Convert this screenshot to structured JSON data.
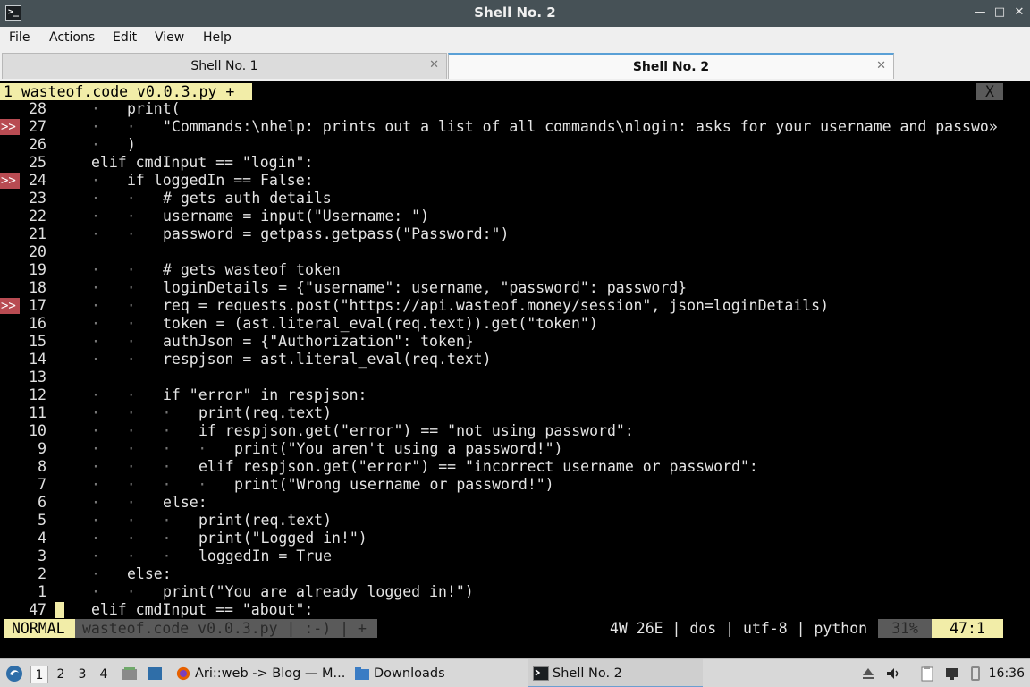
{
  "window": {
    "title": "Shell No. 2",
    "controls": {
      "minimize": "—",
      "maximize": "□",
      "close": "✕"
    }
  },
  "menu": [
    "File",
    "Actions",
    "Edit",
    "View",
    "Help"
  ],
  "tabs": [
    {
      "label": "Shell No. 1",
      "close": "✕",
      "active": false
    },
    {
      "label": "Shell No. 2",
      "close": "✕",
      "active": true
    }
  ],
  "vim": {
    "buffer_tab": "1 wasteof.code v0.0.3.py +",
    "buffer_close": "X",
    "lines": [
      {
        "num": "28",
        "sign": "",
        "guides": "·",
        "code": "print("
      },
      {
        "num": "27",
        "sign": ">>",
        "guides": "·   ·",
        "code": "\"Commands:\\nhelp: prints out a list of all commands\\nlogin: asks for your username and passwo»"
      },
      {
        "num": "26",
        "sign": "",
        "guides": "·",
        "code": ")"
      },
      {
        "num": "25",
        "sign": "",
        "guides": "",
        "code": "elif cmdInput == \"login\":"
      },
      {
        "num": "24",
        "sign": ">>",
        "guides": "·",
        "code": "if loggedIn == False:"
      },
      {
        "num": "23",
        "sign": "",
        "guides": "·   ·",
        "code": "# gets auth details"
      },
      {
        "num": "22",
        "sign": "",
        "guides": "·   ·",
        "code": "username = input(\"Username: \")"
      },
      {
        "num": "21",
        "sign": "",
        "guides": "·   ·",
        "code": "password = getpass.getpass(\"Password:\")"
      },
      {
        "num": "20",
        "sign": "",
        "guides": "",
        "code": ""
      },
      {
        "num": "19",
        "sign": "",
        "guides": "·   ·",
        "code": "# gets wasteof token"
      },
      {
        "num": "18",
        "sign": "",
        "guides": "·   ·",
        "code": "loginDetails = {\"username\": username, \"password\": password}"
      },
      {
        "num": "17",
        "sign": ">>",
        "guides": "·   ·",
        "code": "req = requests.post(\"https://api.wasteof.money/session\", json=loginDetails)"
      },
      {
        "num": "16",
        "sign": "",
        "guides": "·   ·",
        "code": "token = (ast.literal_eval(req.text)).get(\"token\")"
      },
      {
        "num": "15",
        "sign": "",
        "guides": "·   ·",
        "code": "authJson = {\"Authorization\": token}"
      },
      {
        "num": "14",
        "sign": "",
        "guides": "·   ·",
        "code": "respjson = ast.literal_eval(req.text)"
      },
      {
        "num": "13",
        "sign": "",
        "guides": "",
        "code": ""
      },
      {
        "num": "12",
        "sign": "",
        "guides": "·   ·",
        "code": "if \"error\" in respjson:"
      },
      {
        "num": "11",
        "sign": "",
        "guides": "·   ·   ·",
        "code": "print(req.text)"
      },
      {
        "num": "10",
        "sign": "",
        "guides": "·   ·   ·",
        "code": "if respjson.get(\"error\") == \"not using password\":"
      },
      {
        "num": "9",
        "sign": "",
        "guides": "·   ·   ·   ·",
        "code": "print(\"You aren't using a password!\")"
      },
      {
        "num": "8",
        "sign": "",
        "guides": "·   ·   ·",
        "code": "elif respjson.get(\"error\") == \"incorrect username or password\":"
      },
      {
        "num": "7",
        "sign": "",
        "guides": "·   ·   ·   ·",
        "code": "print(\"Wrong username or password!\")"
      },
      {
        "num": "6",
        "sign": "",
        "guides": "·   ·",
        "code": "else:"
      },
      {
        "num": "5",
        "sign": "",
        "guides": "·   ·   ·",
        "code": "print(req.text)"
      },
      {
        "num": "4",
        "sign": "",
        "guides": "·   ·   ·",
        "code": "print(\"Logged in!\")"
      },
      {
        "num": "3",
        "sign": "",
        "guides": "·   ·   ·",
        "code": "loggedIn = True"
      },
      {
        "num": "2",
        "sign": "",
        "guides": "·",
        "code": "else:"
      },
      {
        "num": "1",
        "sign": "",
        "guides": "·   ·",
        "code": "print(\"You are already logged in!\")"
      },
      {
        "num": "47",
        "sign": "",
        "guides": "",
        "code": "elif cmdInput == \"about\":"
      }
    ],
    "status": {
      "mode": "NORMAL",
      "file": "wasteof.code v0.0.3.py | :-) | +",
      "info": "4W 26E | dos | utf-8 | python",
      "percent": "31%",
      "position": "47:1"
    }
  },
  "taskbar": {
    "workspaces": [
      "1",
      "2",
      "3",
      "4"
    ],
    "tasks": [
      {
        "label": "Ari::web -> Blog — M...",
        "icon": "firefox-icon"
      },
      {
        "label": "Downloads",
        "icon": "folder-icon"
      },
      {
        "label": "Shell No. 2",
        "icon": "terminal-icon"
      }
    ],
    "clock": "16:36"
  }
}
